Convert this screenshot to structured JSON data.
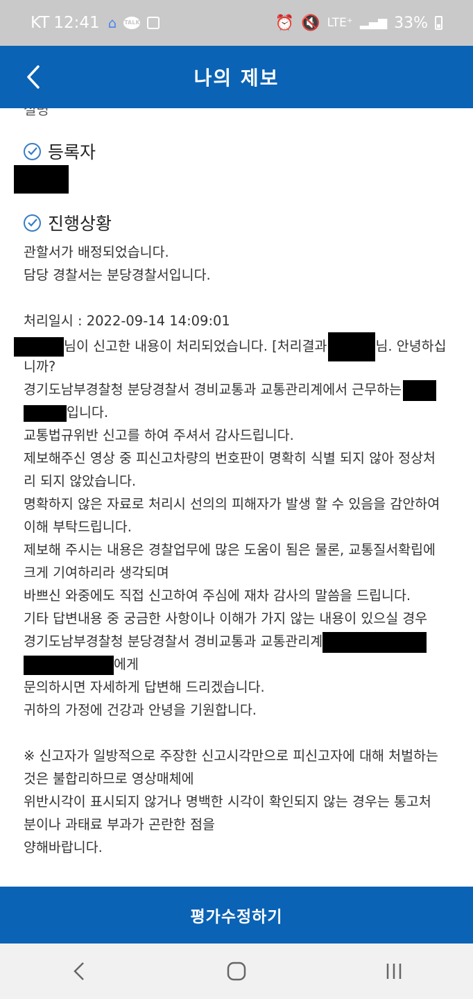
{
  "status_bar": {
    "carrier": "KT",
    "time": "12:41",
    "network": "LTE⁺",
    "battery": "33%"
  },
  "header": {
    "title": "나의 제보"
  },
  "content": {
    "cut_text": "설명",
    "registrant_heading": "등록자",
    "progress_heading": "진행상황",
    "lines": [
      "관할서가 배정되었습니다.",
      "담당 경찰서는 분당경찰서입니다.",
      "",
      "처리일시 : 2022-09-14 14:09:01",
      "님이 신고한 내용이 처리되었습니다. [처리결과",
      "님. 안녕하십",
      "니까?",
      "경기도남부경찰청 분당경찰서 경비교통과 교통관리계에서 근무하는",
      "입니다.",
      "교통법규위반 신고를 하여 주셔서 감사드립니다.",
      "제보해주신 영상 중 피신고차량의 번호판이 명확히 식별 되지 않아 정상처",
      "리 되지 않았습니다.",
      "명확하지 않은 자료로 처리시 선의의 피해자가 발생 할 수 있음을 감안하여",
      "이해 부탁드립니다.",
      "제보해 주시는 내용은 경찰업무에 많은 도움이 됨은 물론, 교통질서확립에",
      "크게 기여하리라 생각되며",
      "바쁘신 와중에도 직접 신고하여 주심에 재차 감사의 말씀을 드립니다.",
      "기타 답변내용 중 궁금한 사항이나 이해가 가지 않는 내용이 있으실 경우",
      "경기도남부경찰청 분당경찰서 경비교통과 교통관리계",
      "에게",
      "문의하시면 자세하게 답변해 드리겠습니다.",
      "귀하의 가정에 건강과 안녕을 기원합니다.",
      "",
      "※ 신고자가 일방적으로 주장한 신고시각만으로 피신고자에 대해 처벌하는",
      "것은 불합리하므로 영상매체에",
      "위반시각이 표시되지 않거나 명백한 시각이 확인되지 않는 경우는 통고처",
      "분이나 과태료 부과가 곤란한 점을",
      "양해바랍니다."
    ]
  },
  "bottom_button": {
    "label": "평가수정하기"
  },
  "nav": {
    "back": "back-icon",
    "home": "home-icon",
    "recents": "recents-icon"
  }
}
